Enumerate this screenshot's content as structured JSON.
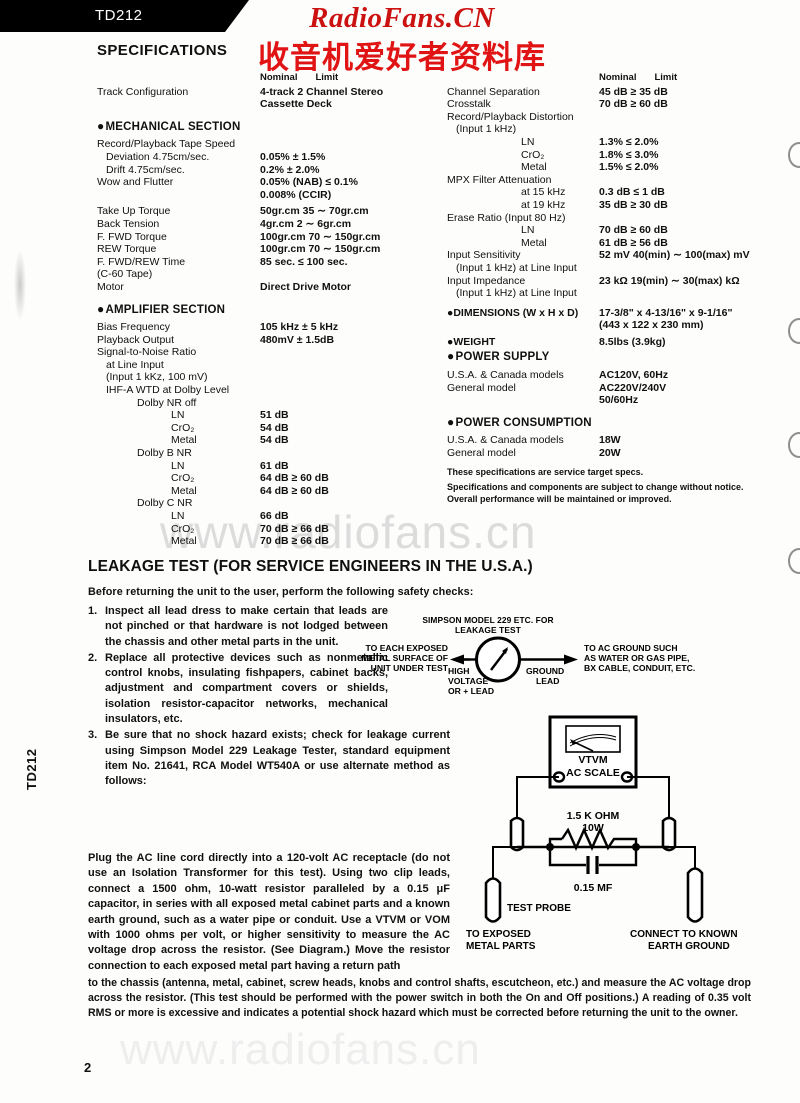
{
  "page": {
    "model_tab": "TD212",
    "side_id": "TD212",
    "page_number": "2",
    "watermark_en": "RadioFans.CN",
    "watermark_cn": "收音机爱好者资料库",
    "watermark_mid": "www.radiofans.cn",
    "watermark_bottom": "www.radiofans.cn"
  },
  "specifications": {
    "heading": "SPECIFICATIONS",
    "column_headers": {
      "nominal": "Nominal",
      "limit": "Limit"
    },
    "left": {
      "track": {
        "label": "Track Configuration",
        "value_1": "4-track 2 Channel Stereo",
        "value_2": "Cassette Deck"
      },
      "mechanical": {
        "title": "MECHANICAL SECTION",
        "rows": [
          {
            "label": "Record/Playback Tape Speed",
            "value": ""
          },
          {
            "label": "Deviation 4.75cm/sec.",
            "value": "0.05% ± 1.5%",
            "indent": 1
          },
          {
            "label": "Drift 4.75cm/sec.",
            "value": "0.2% ± 2.0%",
            "indent": 1
          },
          {
            "label": "Wow and Flutter",
            "value": "0.05%  (NAB) ≤ 0.1%"
          },
          {
            "label": "",
            "value": "0.008%  (CCIR)"
          },
          {
            "label": "Take Up Torque",
            "value": "50gr.cm 35 ∼ 70gr.cm",
            "spacer": true
          },
          {
            "label": "Back Tension",
            "value": "4gr.cm  2 ∼ 6gr.cm"
          },
          {
            "label": "F. FWD Torque",
            "value": "100gr.cm 70 ∼ 150gr.cm"
          },
          {
            "label": "REW Torque",
            "value": "100gr.cm 70 ∼ 150gr.cm"
          },
          {
            "label": "F. FWD/REW Time",
            "value": "85 sec. ≤ 100 sec."
          },
          {
            "label": "(C-60 Tape)",
            "value": ""
          },
          {
            "label": "Motor",
            "value": "Direct Drive Motor"
          }
        ]
      },
      "amplifier": {
        "title": "AMPLIFIER SECTION",
        "rows": [
          {
            "label": "Bias Frequency",
            "value": "105 kHz ± 5 kHz"
          },
          {
            "label": "Playback Output",
            "value": "480mV ± 1.5dB"
          },
          {
            "label": "Signal-to-Noise Ratio",
            "value": ""
          },
          {
            "label": "at Line Input",
            "value": "",
            "indent": 1
          },
          {
            "label": "(Input 1 kKz, 100 mV)",
            "value": "",
            "indent": 1
          },
          {
            "label": "IHF-A WTD at Dolby Level",
            "value": "",
            "indent": 1
          },
          {
            "label": "Dolby NR off",
            "value": "",
            "indent": 2
          },
          {
            "label": "LN",
            "value": "51 dB",
            "indent": 3
          },
          {
            "label": "CrO₂",
            "value": "54 dB",
            "indent": 3
          },
          {
            "label": "Metal",
            "value": "54 dB",
            "indent": 3
          },
          {
            "label": "Dolby B NR",
            "value": "",
            "indent": 2
          },
          {
            "label": "LN",
            "value": "61 dB",
            "indent": 3
          },
          {
            "label": "CrO₂",
            "value": "64 dB ≥ 60 dB",
            "indent": 3
          },
          {
            "label": "Metal",
            "value": "64 dB ≥ 60 dB",
            "indent": 3
          },
          {
            "label": "Dolby C NR",
            "value": "",
            "indent": 2
          },
          {
            "label": "LN",
            "value": "66 dB",
            "indent": 3
          },
          {
            "label": "CrO₂",
            "value": "70 dB ≥ 66 dB",
            "indent": 3
          },
          {
            "label": "Metal",
            "value": "70 dB ≥ 66 dB",
            "indent": 3
          }
        ]
      }
    },
    "right": {
      "rows": [
        {
          "label": "Channel Separation",
          "value": "45 dB ≥ 35 dB"
        },
        {
          "label": "Crosstalk",
          "value": "70 dB ≥ 60 dB"
        },
        {
          "label": "Record/Playback Distortion",
          "value": ""
        },
        {
          "label": "(Input 1 kHz)",
          "value": "",
          "indent": 1
        },
        {
          "label": "LN",
          "value": "1.3% ≤ 2.0%",
          "indent": 3
        },
        {
          "label": "CrO₂",
          "value": "1.8% ≤ 3.0%",
          "indent": 3
        },
        {
          "label": "Metal",
          "value": "1.5% ≤ 2.0%",
          "indent": 3
        },
        {
          "label": "MPX Filter Attenuation",
          "value": ""
        },
        {
          "label": "at 15 kHz",
          "value": "0.3 dB ≤ 1 dB",
          "indent": 3
        },
        {
          "label": "at 19 kHz",
          "value": "35 dB ≥ 30 dB",
          "indent": 3
        },
        {
          "label": "Erase Ratio (Input 80 Hz)",
          "value": ""
        },
        {
          "label": "LN",
          "value": "70 dB ≥ 60 dB",
          "indent": 3
        },
        {
          "label": "Metal",
          "value": "61 dB ≥ 56 dB",
          "indent": 3
        },
        {
          "label": "Input Sensitivity",
          "value": "52 mV 40(min) ∼ 100(max) mV"
        },
        {
          "label": "(Input 1 kHz) at Line Input",
          "value": "",
          "indent": 1
        },
        {
          "label": "Input Impedance",
          "value": "23 kΩ 19(min) ∼ 30(max) kΩ"
        },
        {
          "label": "(Input 1 kHz) at Line Input",
          "value": "",
          "indent": 1
        }
      ],
      "dimensions": {
        "title": "DIMENSIONS (W x H x D)",
        "value_1": "17-3/8\" x 4-13/16\" x 9-1/16\"",
        "value_2": "(443 x 122 x 230 mm)"
      },
      "weight": {
        "title": "WEIGHT",
        "value": "8.5lbs  (3.9kg)"
      },
      "power_supply": {
        "title": "POWER SUPPLY",
        "rows": [
          {
            "label": "U.S.A. & Canada models",
            "value": "AC120V, 60Hz"
          },
          {
            "label": "General model",
            "value": "AC220V/240V"
          },
          {
            "label": "",
            "value": "50/60Hz"
          }
        ]
      },
      "power_consumption": {
        "title": "POWER CONSUMPTION",
        "rows": [
          {
            "label": "U.S.A. & Canada models",
            "value": "18W"
          },
          {
            "label": "General model",
            "value": "20W"
          }
        ]
      },
      "notes": [
        "These specifications are service target specs.",
        "Specifications and components are subject to change without notice.",
        "Overall performance will be maintained or improved."
      ]
    }
  },
  "leakage_test": {
    "heading": "LEAKAGE TEST (FOR SERVICE ENGINEERS IN THE U.S.A.)",
    "lead_in": "Before returning the unit to the user, perform the following safety checks:",
    "steps": [
      {
        "num": "1.",
        "text": "Inspect all lead dress to make certain that leads are not pinched or that hardware is not lodged between the chassis and other metal parts in the unit."
      },
      {
        "num": "2.",
        "text": "Replace all protective devices such as nonmetallic control knobs, insulating fishpapers, cabinet backs, adjustment and compartment covers or shields, isolation resistor-capacitor networks, mechanical insulators, etc."
      },
      {
        "num": "3.",
        "text": "Be sure that no shock hazard exists; check for leakage current using Simpson Model 229 Leakage Tester, standard equipment item No. 21641, RCA Model WT540A or use alternate method as follows:"
      }
    ],
    "paragraph_a": "Plug the AC line cord directly into a 120-volt AC receptacle (do not use an Isolation Transformer for this test). Using two clip leads, connect a 1500 ohm, 10-watt resistor paralleled by a 0.15 μF capacitor, in series with all exposed metal cabinet parts and a known earth ground, such as a water pipe or conduit. Use a VTVM or VOM with 1000 ohms per volt, or higher sensitivity to measure the AC voltage drop across the resistor. (See Diagram.) Move the resistor connection to each exposed metal part having a return path",
    "paragraph_b": "to the chassis (antenna, metal, cabinet, screw heads, knobs and control shafts, escutcheon, etc.) and measure the AC voltage drop across the resistor. (This test should be performed with the power switch in both the On and Off positions.) A reading of 0.35 volt RMS or more is excessive and indicates a potential shock hazard which must be corrected before returning the unit to the owner."
  },
  "meter_diagram": {
    "title_line1": "SIMPSON MODEL 229 ETC. FOR",
    "title_line2": "LEAKAGE TEST",
    "left_label_1": "TO EACH EXPOSED",
    "left_label_2": "METAL SURFACE OF",
    "left_label_3": "UNIT UNDER TEST",
    "hv_1": "HIGH",
    "hv_2": "VOLTAGE",
    "hv_3": "OR  + LEAD",
    "gnd_1": "GROUND",
    "gnd_2": "LEAD",
    "right_label_1": "TO AC GROUND SUCH",
    "right_label_2": "AS WATER OR GAS PIPE,",
    "right_label_3": "BX CABLE, CONDUIT, ETC."
  },
  "circuit_diagram": {
    "meter_name": "VTVM",
    "meter_scale": "AC SCALE",
    "resistor_1": "1.5 K OHM",
    "resistor_2": "10W",
    "capacitor": "0.15 MF",
    "probe_label": "TEST PROBE",
    "left_label_1": "TO EXPOSED",
    "left_label_2": "METAL PARTS",
    "right_label_1": "CONNECT TO KNOWN",
    "right_label_2": "EARTH GROUND"
  },
  "colors": {
    "ink": "#101010",
    "watermark_red": "#cc1111",
    "watermark_gray": "#dcdcdc"
  }
}
